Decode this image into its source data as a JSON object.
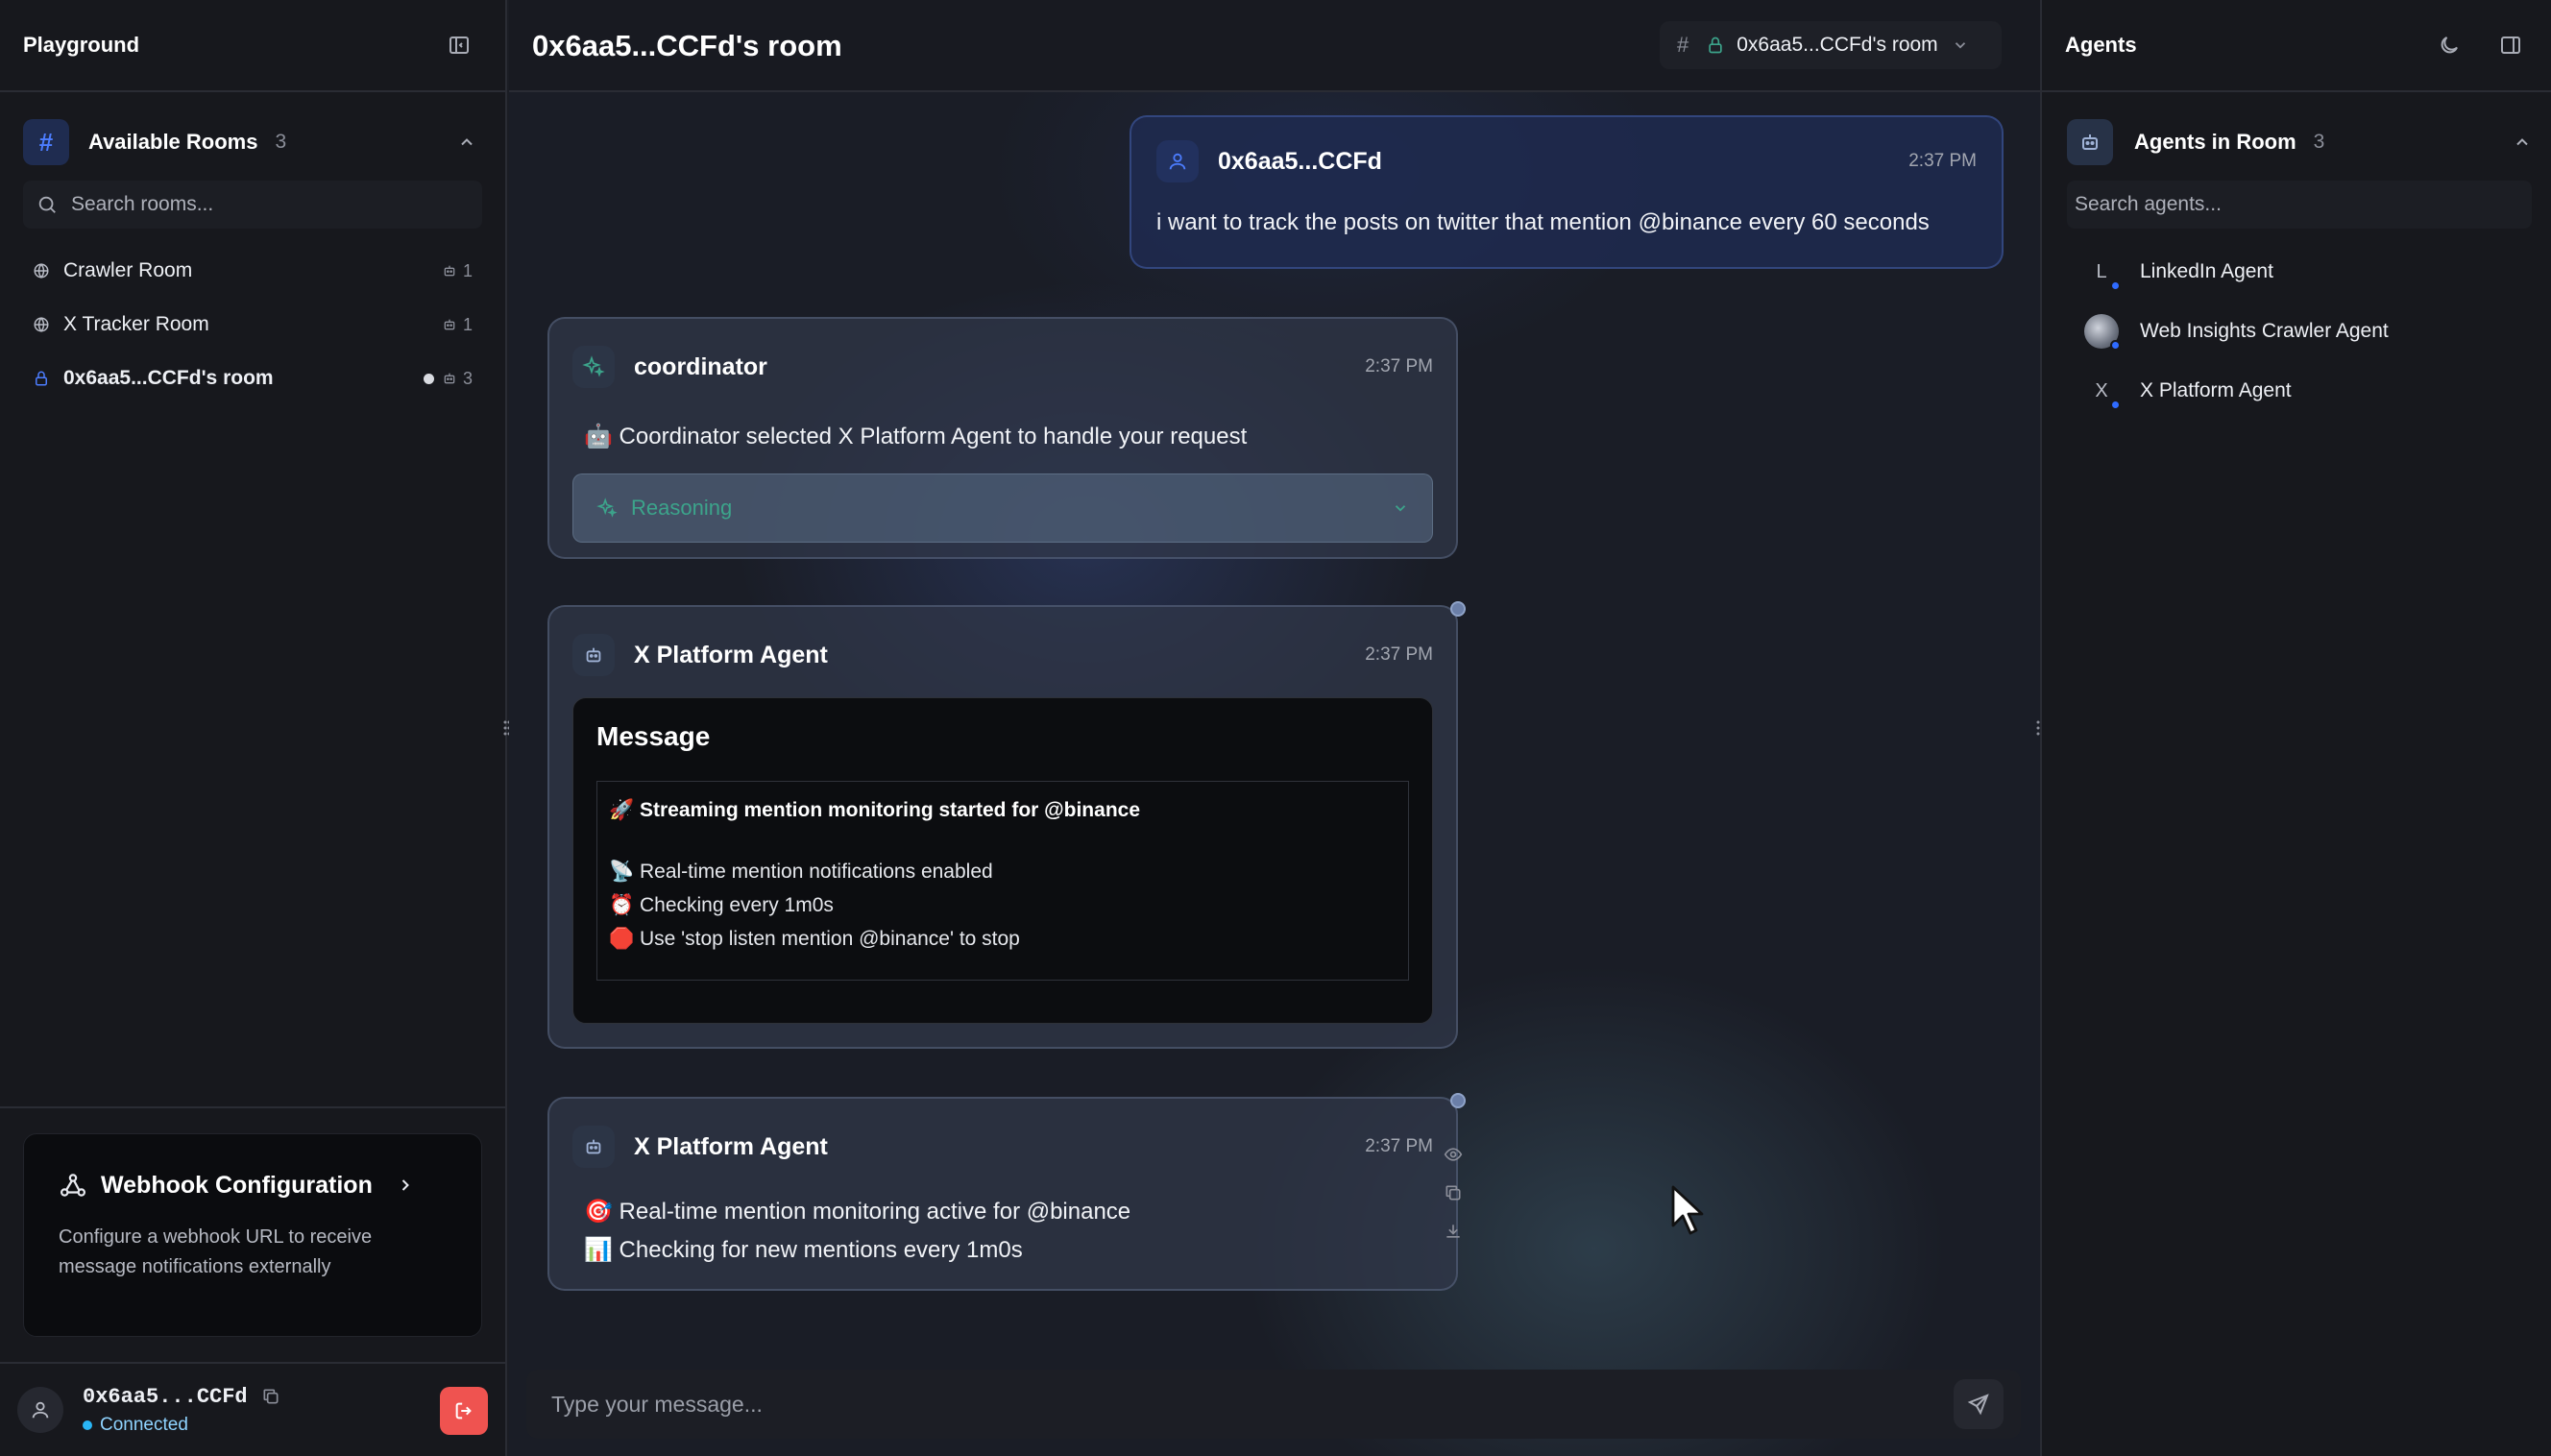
{
  "colors": {
    "accent_blue": "#4c7dff",
    "online_dot": "#2f6bff",
    "connected": "#29b6f6",
    "logout": "#ef5350",
    "reasoning": "#3ca48b"
  },
  "left_sidebar": {
    "title": "Playground",
    "rooms_section": {
      "label": "Available Rooms",
      "count": "3",
      "search_placeholder": "Search rooms...",
      "rooms": [
        {
          "name": "Crawler Room",
          "agents": "1",
          "icon": "globe-icon",
          "active": false
        },
        {
          "name": "X Tracker Room",
          "agents": "1",
          "icon": "globe-icon",
          "active": false
        },
        {
          "name": "0x6aa5...CCFd's room",
          "agents": "3",
          "icon": "lock-icon",
          "active": true
        }
      ]
    },
    "webhook": {
      "title": "Webhook Configuration",
      "description": "Configure a webhook URL to receive message notifications externally"
    },
    "user": {
      "address": "0x6aa5...CCFd",
      "status": "Connected"
    }
  },
  "main": {
    "title": "0x6aa5...CCFd's room",
    "room_selector": "0x6aa5...CCFd's room",
    "messages": {
      "user": {
        "sender": "0x6aa5...CCFd",
        "time": "2:37 PM",
        "text": "i want to track the posts on twitter that mention @binance every 60 seconds"
      },
      "coordinator": {
        "sender": "coordinator",
        "time": "2:37 PM",
        "text": "🤖 Coordinator selected X Platform Agent to handle your request",
        "reasoning_label": "Reasoning"
      },
      "agent1": {
        "sender": "X Platform Agent",
        "time": "2:37 PM",
        "card_title": "Message",
        "headline": "🚀 Streaming mention monitoring started for @binance",
        "lines": [
          "📡 Real-time mention notifications enabled",
          "⏰ Checking every 1m0s",
          "🛑 Use 'stop listen mention @binance' to stop"
        ]
      },
      "agent2": {
        "sender": "X Platform Agent",
        "time": "2:37 PM",
        "line1": "🎯 Real-time mention monitoring active for @binance",
        "line2": "📊 Checking for new mentions every 1m0s"
      }
    },
    "composer_placeholder": "Type your message..."
  },
  "right_sidebar": {
    "title": "Agents",
    "agents_section": {
      "label": "Agents in Room",
      "count": "3",
      "search_placeholder": "Search agents...",
      "agents": [
        {
          "name": "LinkedIn Agent",
          "initial": "L"
        },
        {
          "name": "Web Insights Crawler Agent",
          "initial": ""
        },
        {
          "name": "X Platform Agent",
          "initial": "X"
        }
      ]
    }
  }
}
